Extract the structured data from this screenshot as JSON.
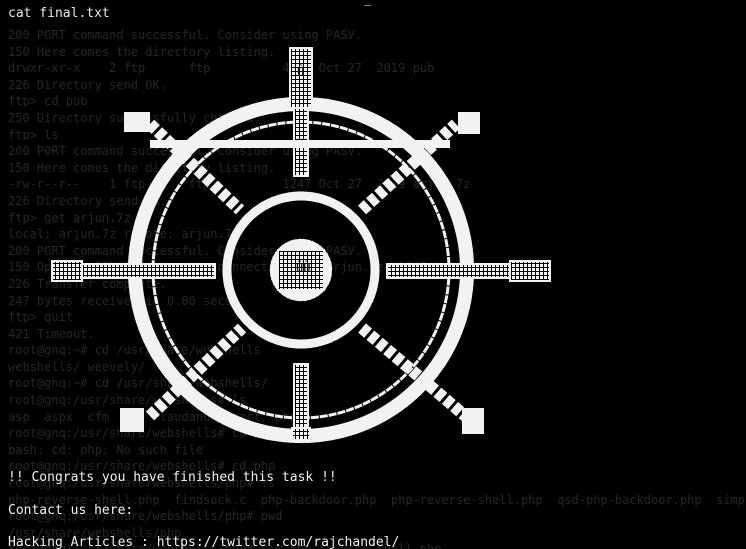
{
  "window": {
    "title_mark": "—"
  },
  "terminal": {
    "command": "cat final.txt",
    "background_lines": [
      "200 PORT command successful. Consider using PASV.",
      "150 Here comes the directory listing.",
      "drwxr-xr-x    2 ftp      ftp          4096 Oct 27  2019 pub",
      "226 Directory send OK.",
      "ftp> cd pub",
      "250 Directory successfully changed.",
      "ftp> ls",
      "200 PORT command successful. Consider using PASV.",
      "150 Here comes the directory listing.",
      "-rw-r--r--    1 ftp      ftp          1247 Oct 27  2019 arjun.7z",
      "226 Directory send OK.",
      "ftp> get arjun.7z",
      "local: arjun.7z remote: arjun.7z",
      "200 PORT command successful. Consider using PASV.",
      "150 Opening BINARY mode data connection for arjun.7z (1247 bytes).",
      "226 Transfer complete.",
      "247 bytes received in 0.00 secs",
      "ftp> quit",
      "421 Timeout.",
      "root@gnq:~# cd /usr/share/webshells",
      "webshells/ weevely/",
      "root@gnq:~# cd /usr/share/webshells/",
      "root@gnq:/usr/share/webshells# ls",
      "asp  aspx  cfm  jsp  laudanum  perl  php",
      "root@gnq:/usr/share/webshells# cd php",
      "bash: cd: php: No such file",
      "root@gnq:/usr/share/webshells# cd php",
      "root@gnq:/usr/share/webshells/php# ls",
      "php-reverse-shell.php  findsock.c  php-backdoor.php  php-reverse-shell.php  qsd-php-backdoor.php  simple-backdoor.php",
      "root@gnq:/usr/share/webshells/php# pwd",
      "/usr/share/webshells/php",
      "root@gnq:/usr/share/webshells/php# vim php-reverse-shell.php"
    ],
    "messages": {
      "congrats": "!! Congrats you have finished this task !!",
      "contact": "Contact us here:",
      "hacking": "Hacking Articles : https://twitter.com/rajchandel/"
    }
  },
  "art": {
    "subject": "ship's steering wheel drawn in ASCII characters",
    "color": "#ffffff"
  }
}
